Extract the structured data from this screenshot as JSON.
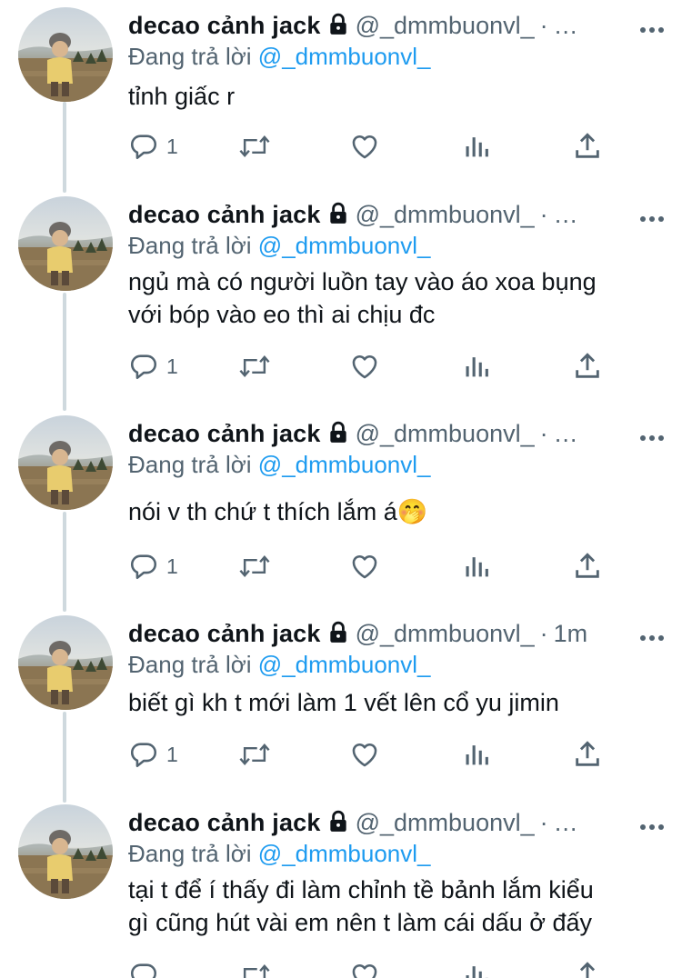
{
  "author": {
    "display_name": "decao cảnh jack",
    "handle": "@_dmmbuonvl_"
  },
  "reply_prefix": "Đang trả lời",
  "reply_to": "@_dmmbuonvl_",
  "icons": {
    "lock": "lock-icon",
    "more": "more-icon",
    "reply": "reply-icon",
    "retweet": "retweet-icon",
    "like": "heart-icon",
    "views": "views-icon",
    "share": "share-icon"
  },
  "colors": {
    "text": "#0f1419",
    "secondary": "#536471",
    "link": "#1d9bf0",
    "thread_line": "#cfd9de"
  },
  "tweets": [
    {
      "separator": "·",
      "time": "…",
      "text": "tỉnh giấc r",
      "reply_count": "1"
    },
    {
      "separator": "·",
      "time": "…",
      "text": "ngủ mà có người luồn tay vào áo xoa bụng\nvới bóp vào eo thì ai chịu đc",
      "reply_count": "1"
    },
    {
      "separator": "·",
      "time": "…",
      "text": "nói v th chứ t thích lắm á🤭",
      "reply_count": "1"
    },
    {
      "separator": "·",
      "time": "1m",
      "text": "biết gì kh t mới làm 1 vết lên cổ yu jimin",
      "reply_count": "1"
    },
    {
      "separator": "·",
      "time": "…",
      "text": "tại t để í thấy đi làm chỉnh tề bảnh lắm kiểu\ngì cũng hút vài em nên t làm cái dấu ở đấy",
      "reply_count": ""
    }
  ]
}
